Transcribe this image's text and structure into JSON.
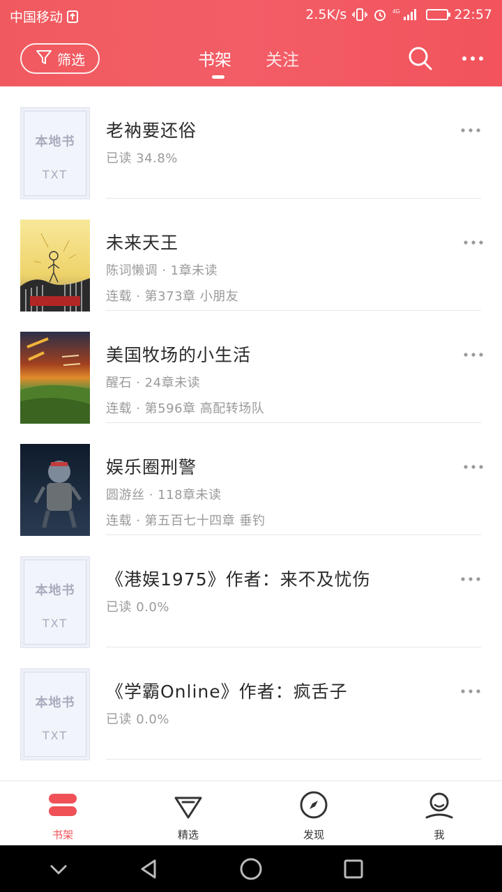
{
  "status_bar": {
    "carrier": "中国移动",
    "speed": "2.5K/s",
    "network": "4G",
    "time": "22:57"
  },
  "toolbar": {
    "filter_label": "筛选",
    "tabs": [
      {
        "label": "书架",
        "active": true
      },
      {
        "label": "关注",
        "active": false
      }
    ]
  },
  "books": [
    {
      "title": "老衲要还俗",
      "line1": "已读 34.8%",
      "line2": "",
      "cover": "local",
      "cover_title": "本地书",
      "cover_type": "TXT"
    },
    {
      "title": "未来天王",
      "line1": "陈词懒调 · 1章未读",
      "line2": "连载 · 第373章 小朋友",
      "cover": "art-1"
    },
    {
      "title": "美国牧场的小生活",
      "line1": "醒石 · 24章未读",
      "line2": "连载 · 第596章 高配转场队",
      "cover": "art-2"
    },
    {
      "title": "娱乐圈刑警",
      "line1": "圆游丝 · 118章未读",
      "line2": "连载 · 第五百七十四章 垂钓",
      "cover": "art-3"
    },
    {
      "title": "《港娱1975》作者：来不及忧伤",
      "line1": "已读 0.0%",
      "line2": "",
      "cover": "local",
      "cover_title": "本地书",
      "cover_type": "TXT"
    },
    {
      "title": "《学霸Online》作者：疯舌子",
      "line1": "已读 0.0%",
      "line2": "",
      "cover": "local",
      "cover_title": "本地书",
      "cover_type": "TXT"
    }
  ],
  "bottom_nav": [
    {
      "label": "书架",
      "icon": "bookshelf-icon",
      "active": true
    },
    {
      "label": "精选",
      "icon": "diamond-icon",
      "active": false
    },
    {
      "label": "发现",
      "icon": "compass-icon",
      "active": false
    },
    {
      "label": "我",
      "icon": "profile-icon",
      "active": false
    }
  ],
  "colors": {
    "accent": "#ef5157",
    "header_gradient_start": "#f05a5f",
    "header_gradient_end": "#f2535c"
  }
}
